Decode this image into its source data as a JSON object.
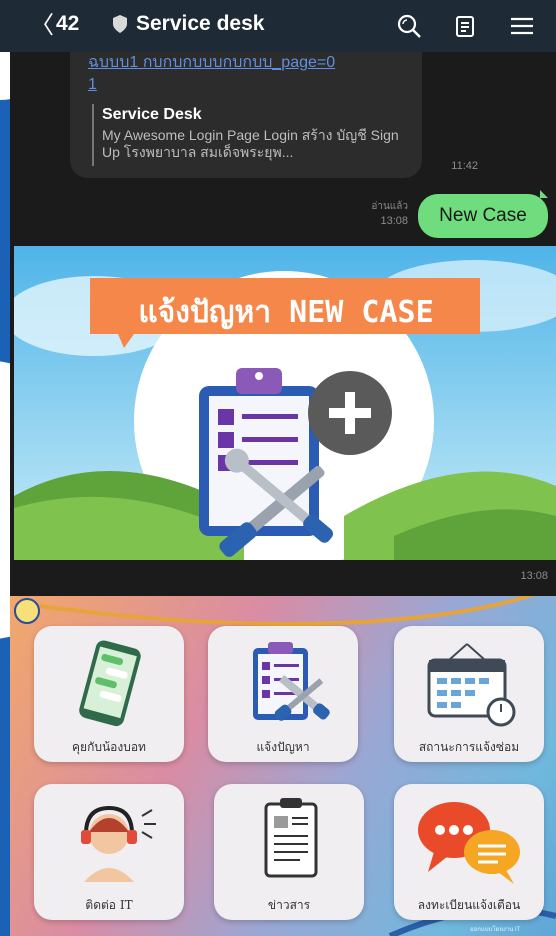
{
  "header": {
    "back_label": "〈",
    "unread_count": "42",
    "title": "Service desk"
  },
  "chat": {
    "link_message": {
      "url_text": "ฉบบบ1 กบกบกบบบกบกบบ_page=0\n1",
      "preview_title": "Service Desk",
      "preview_description": "My Awesome Login Page Login สร้าง บัญชี Sign Up โรงพยาบาล สมเด็จพระยุพ...",
      "time": "11:42"
    },
    "sent_message": {
      "text": "New Case",
      "read_status": "อ่านแล้ว",
      "time": "13:08"
    },
    "image_message": {
      "banner_text": "แจ้งปัญหา NEW CASE",
      "time": "13:08"
    }
  },
  "rich_menu": {
    "items": [
      {
        "label": "คุยกับน้องบอท",
        "icon": "chat-phone-icon"
      },
      {
        "label": "แจ้งปัญหา",
        "icon": "clipboard-tools-icon"
      },
      {
        "label": "สถานะการแจ้งซ่อม",
        "icon": "calendar-clock-icon"
      },
      {
        "label": "ติดต่อ IT",
        "icon": "headset-agent-icon"
      },
      {
        "label": "ข่าวสาร",
        "icon": "news-clipboard-icon"
      },
      {
        "label": "ลงทะเบียนแจ้งเตือน",
        "icon": "speech-bubbles-icon"
      }
    ],
    "footer": "ออกแบบโดยงาน IT"
  },
  "colors": {
    "header_bg": "#1e2a36",
    "chat_bg": "#1b1b1b",
    "sent_bubble": "#6fdc7d",
    "banner_orange": "#f5874a",
    "outer_bg": "#1d5fb3"
  }
}
